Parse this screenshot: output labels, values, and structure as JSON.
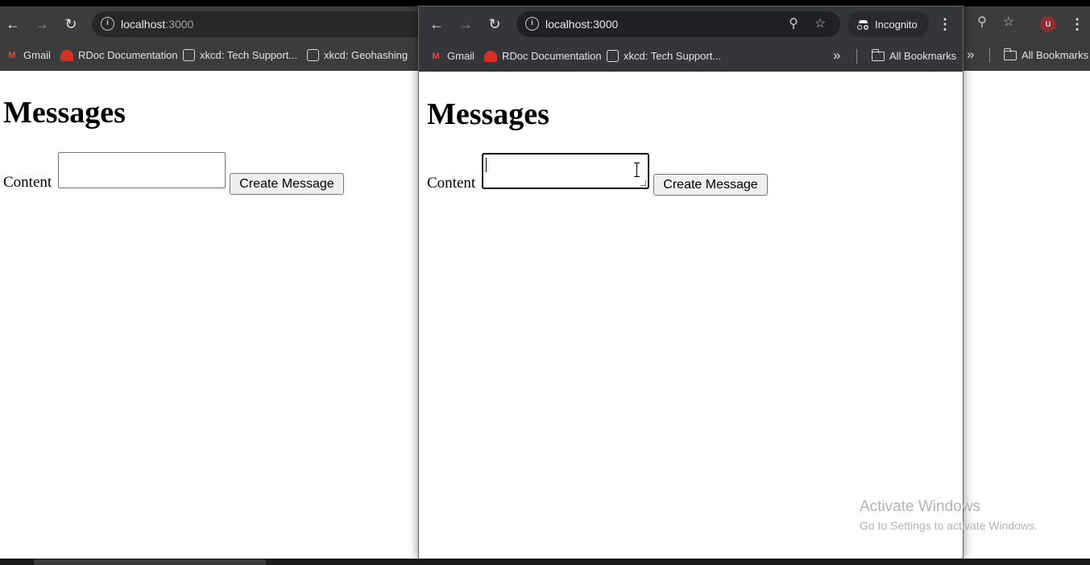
{
  "back_browser": {
    "url_host": "localhost",
    "url_port": ":3000",
    "bookmarks": [
      {
        "label": "Gmail",
        "icon": "gmail-icon"
      },
      {
        "label": "RDoc Documentation",
        "icon": "rdoc-icon"
      },
      {
        "label": "xkcd: Tech Support...",
        "icon": "xkcd-icon"
      },
      {
        "label": "xkcd: Geohashing",
        "icon": "xkcd-icon"
      }
    ],
    "all_bookmarks_label": "All Bookmarks",
    "profile_initial": "u",
    "page": {
      "heading": "Messages",
      "content_label": "Content",
      "content_value": "",
      "submit_label": "Create Message"
    }
  },
  "front_browser": {
    "url": "localhost:3000",
    "incognito_label": "Incognito",
    "bookmarks": [
      {
        "label": "Gmail",
        "icon": "gmail-icon"
      },
      {
        "label": "RDoc Documentation",
        "icon": "rdoc-icon"
      },
      {
        "label": "xkcd: Tech Support...",
        "icon": "xkcd-icon"
      }
    ],
    "all_bookmarks_label": "All Bookmarks",
    "page": {
      "heading": "Messages",
      "content_label": "Content",
      "content_value": "",
      "content_focused": true,
      "submit_label": "Create Message"
    }
  },
  "watermark": {
    "title": "Activate Windows",
    "subtitle": "Go to Settings to activate Windows."
  },
  "colors": {
    "toolbar_back": "#3c3c3c",
    "toolbar_incognito": "#35363a",
    "omnibox_bg": "#282828",
    "profile_avatar": "#8c2f2f"
  }
}
